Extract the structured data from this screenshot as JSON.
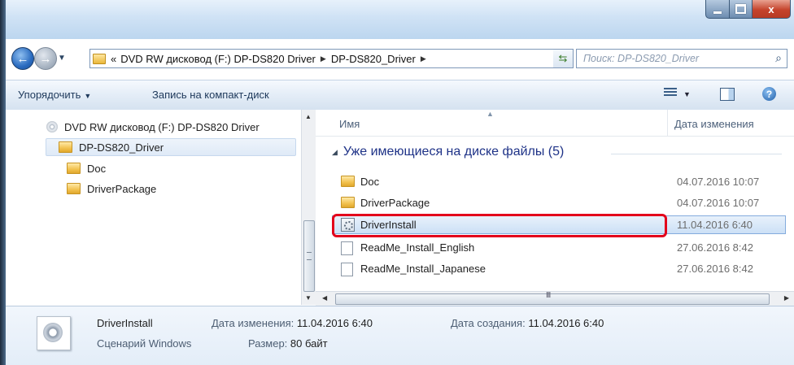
{
  "titlebar": {
    "buttons": {
      "minimize": "minimize",
      "maximize": "maximize",
      "close": "x"
    }
  },
  "address": {
    "overflow": "«",
    "segments": [
      "DVD RW дисковод (F:) DP-DS820 Driver",
      "DP-DS820_Driver"
    ],
    "search_placeholder": "Поиск: DP-DS820_Driver"
  },
  "toolbar": {
    "organize_label": "Упорядочить",
    "burn_label": "Запись на компакт-диск"
  },
  "navpane": {
    "items": [
      {
        "label": "DVD RW дисковод (F:) DP-DS820 Driver",
        "icon": "dvd-drive-icon"
      },
      {
        "label": "DP-DS820_Driver",
        "icon": "folder-icon",
        "selected": true
      },
      {
        "label": "Doc",
        "icon": "folder-icon"
      },
      {
        "label": "DriverPackage",
        "icon": "folder-icon"
      }
    ]
  },
  "content": {
    "columns": {
      "name": "Имя",
      "date": "Дата изменения"
    },
    "group_title": "Уже имеющиеся на диске файлы (5)",
    "files": [
      {
        "name": "Doc",
        "date": "04.07.2016 10:07",
        "icon": "folder-icon"
      },
      {
        "name": "DriverPackage",
        "date": "04.07.2016 10:07",
        "icon": "folder-icon"
      },
      {
        "name": "DriverInstall",
        "date": "11.04.2016 6:40",
        "icon": "script-icon",
        "selected": true
      },
      {
        "name": "ReadMe_Install_English",
        "date": "27.06.2016 8:42",
        "icon": "document-icon"
      },
      {
        "name": "ReadMe_Install_Japanese",
        "date": "27.06.2016 8:42",
        "icon": "document-icon"
      }
    ],
    "hscroll_grip": "III"
  },
  "details": {
    "name": "DriverInstall",
    "type": "Сценарий Windows",
    "modified_label": "Дата изменения:",
    "modified_value": "11.04.2016 6:40",
    "size_label": "Размер:",
    "size_value": "80 байт",
    "created_label": "Дата создания:",
    "created_value": "11.04.2016 6:40"
  },
  "colors": {
    "highlight": "#e3001b",
    "group_title": "#1e3287",
    "selection": "#cce0f6"
  }
}
